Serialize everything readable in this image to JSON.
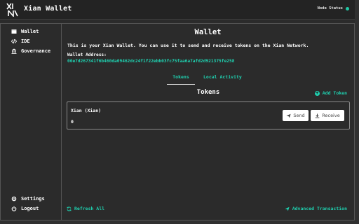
{
  "header": {
    "app_title": "Xian Wallet",
    "node_status_label": "Node Status",
    "status_color": "#1fc8a5"
  },
  "sidebar": {
    "items": [
      {
        "label": "Wallet",
        "icon": "wallet-icon"
      },
      {
        "label": "IDE",
        "icon": "code-icon"
      },
      {
        "label": "Governance",
        "icon": "bank-icon"
      }
    ],
    "bottom_items": [
      {
        "label": "Settings",
        "icon": "gear-icon"
      },
      {
        "label": "Logout",
        "icon": "power-icon"
      }
    ]
  },
  "main": {
    "title": "Wallet",
    "description": "This is your Xian Wallet. You can use it to send and receive tokens on the Xian Network.",
    "address_label": "Wallet Address:",
    "address_value": "00e7d267341f6b460da09462dc24f1f22ebb03fc75faa6a7afd2d921375fe258",
    "tabs": [
      {
        "label": "Tokens",
        "active": true
      },
      {
        "label": "Local Activity",
        "active": false
      }
    ],
    "tokens_heading": "Tokens",
    "add_token_label": "Add Token",
    "token": {
      "name": "Xian (Xian)",
      "balance": "0",
      "send_label": "Send",
      "receive_label": "Receive"
    },
    "refresh_label": "Refresh All",
    "advanced_label": "Advanced Transaction"
  },
  "colors": {
    "accent": "#1fd1b0",
    "background": "#2b2b2b",
    "header": "#232323"
  }
}
